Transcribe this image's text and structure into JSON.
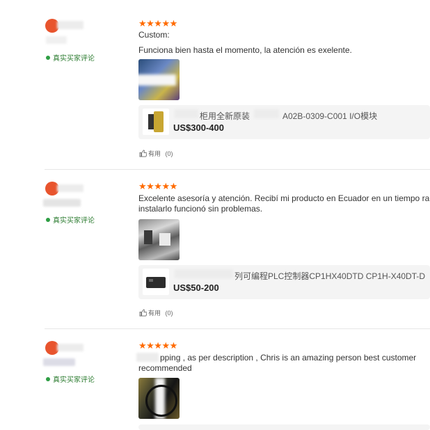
{
  "reviews": [
    {
      "stars": "★★★★★",
      "text_line1": "Custom:",
      "text_line2": "Funciona bien hasta el momento, la atención es exelente.",
      "verified": "真实买家评论",
      "product_name": "A02B-0309-C001 I/O模块",
      "product_name_prefix": "柜用全新原装",
      "product_price": "US$300-400",
      "helpful_label": "有用",
      "helpful_count": "(0)",
      "avatar_color": "#e8542d"
    },
    {
      "stars": "★★★★★",
      "text_line1": "Excelente asesoría y atención. Recibí mi producto en Ecuador en un tiempo ra",
      "text_line2": "instalarlo funcionó sin problemas.",
      "verified": "真实买家评论",
      "product_name": "列可编程PLC控制器CP1HX40DTD CP1H-X40DT-D",
      "product_price": "US$50-200",
      "helpful_label": "有用",
      "helpful_count": "(0)",
      "avatar_color": "#e8542d"
    },
    {
      "stars": "★★★★★",
      "text_line1": "pping , as per description , Chris is an amazing person best customer",
      "text_line2": "recommended",
      "verified": "真实买家评论",
      "avatar_color": "#e8542d"
    }
  ],
  "colors": {
    "star": "#ff6a00",
    "verified": "#2e9e44",
    "card_bg": "#f4f4f4"
  }
}
